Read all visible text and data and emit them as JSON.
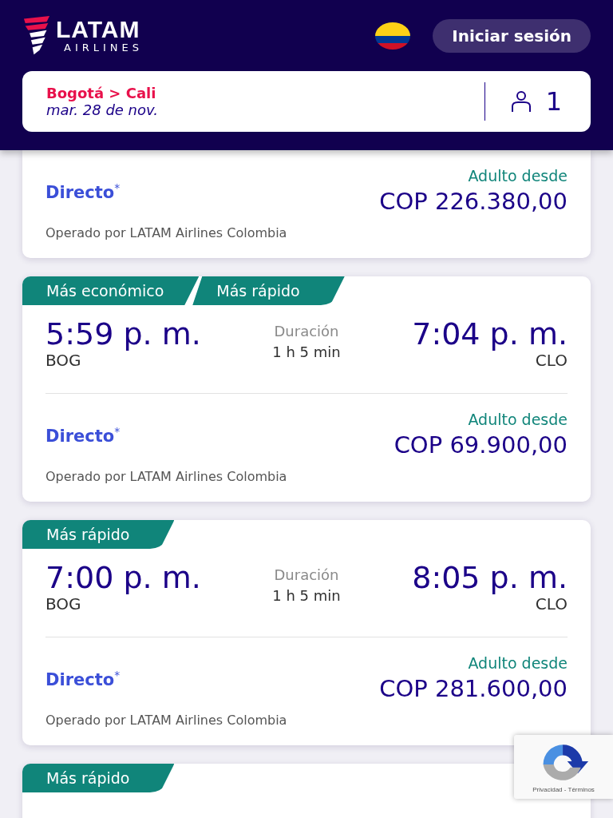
{
  "header": {
    "logo_text": "LATAM",
    "logo_subtext": "AIRLINES",
    "login_button": "Iniciar sesión"
  },
  "search": {
    "route": "Bogotá > Cali",
    "date": "mar. 28 de nov.",
    "passengers": "1"
  },
  "flights": [
    {
      "fare": {
        "fare_type": "Directo",
        "footnote": "*",
        "price_label": "Adulto desde",
        "price": "COP 226.380,00",
        "operator": "Operado por LATAM Airlines Colombia"
      }
    },
    {
      "tags": [
        "Más económico",
        "Más rápido"
      ],
      "depart_time": "5:59 p. m.",
      "depart_code": "BOG",
      "duration_label": "Duración",
      "duration": "1 h 5 min",
      "arrive_time": "7:04 p. m.",
      "arrive_code": "CLO",
      "fare": {
        "fare_type": "Directo",
        "footnote": "*",
        "price_label": "Adulto desde",
        "price": "COP 69.900,00",
        "operator": "Operado por LATAM Airlines Colombia"
      }
    },
    {
      "tags": [
        "Más rápido"
      ],
      "depart_time": "7:00 p. m.",
      "depart_code": "BOG",
      "duration_label": "Duración",
      "duration": "1 h 5 min",
      "arrive_time": "8:05 p. m.",
      "arrive_code": "CLO",
      "fare": {
        "fare_type": "Directo",
        "footnote": "*",
        "price_label": "Adulto desde",
        "price": "COP 281.600,00",
        "operator": "Operado por LATAM Airlines Colombia"
      }
    },
    {
      "tags": [
        "Más rápido"
      ]
    }
  ],
  "recaptcha": {
    "links": "Privacidad - Términos"
  }
}
